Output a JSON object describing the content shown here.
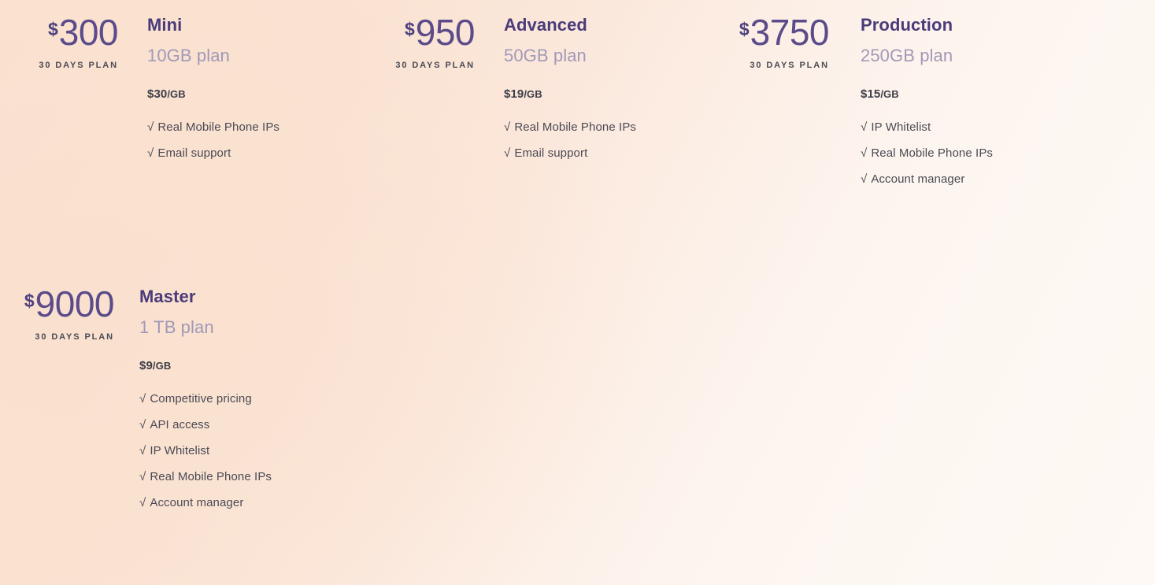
{
  "plans": [
    {
      "id": "mini",
      "currency": "$",
      "amount": "300",
      "period": "30 DAYS PLAN",
      "name": "Mini",
      "size": "10GB plan",
      "rate_value": "$30",
      "rate_unit": "/GB",
      "features": [
        "Real Mobile Phone IPs",
        "Email support"
      ]
    },
    {
      "id": "advanced",
      "currency": "$",
      "amount": "950",
      "period": "30 DAYS PLAN",
      "name": "Advanced",
      "size": "50GB plan",
      "rate_value": "$19",
      "rate_unit": "/GB",
      "features": [
        "Real Mobile Phone IPs",
        "Email support"
      ]
    },
    {
      "id": "production",
      "currency": "$",
      "amount": "3750",
      "period": "30 DAYS PLAN",
      "name": "Production",
      "size": "250GB plan",
      "rate_value": "$15",
      "rate_unit": "/GB",
      "features": [
        "IP Whitelist",
        "Real Mobile Phone IPs",
        "Account manager"
      ]
    },
    {
      "id": "master",
      "currency": "$",
      "amount": "9000",
      "period": "30 DAYS PLAN",
      "name": "Master",
      "size": "1 TB plan",
      "rate_value": "$9",
      "rate_unit": "/GB",
      "features": [
        "Competitive pricing",
        "API access",
        "IP Whitelist",
        "Real Mobile Phone IPs",
        "Account manager"
      ]
    }
  ],
  "icons": {
    "check": "√"
  },
  "colors": {
    "price_amount": "#5B4B8A",
    "currency": "#4E4080",
    "plan_name": "#4A3B7A",
    "plan_size": "#A099B8",
    "rate": "#3E3E48",
    "feature_text": "#4A4A55",
    "background_start": "#FAE1D0",
    "background_end": "#FEF9F4"
  }
}
